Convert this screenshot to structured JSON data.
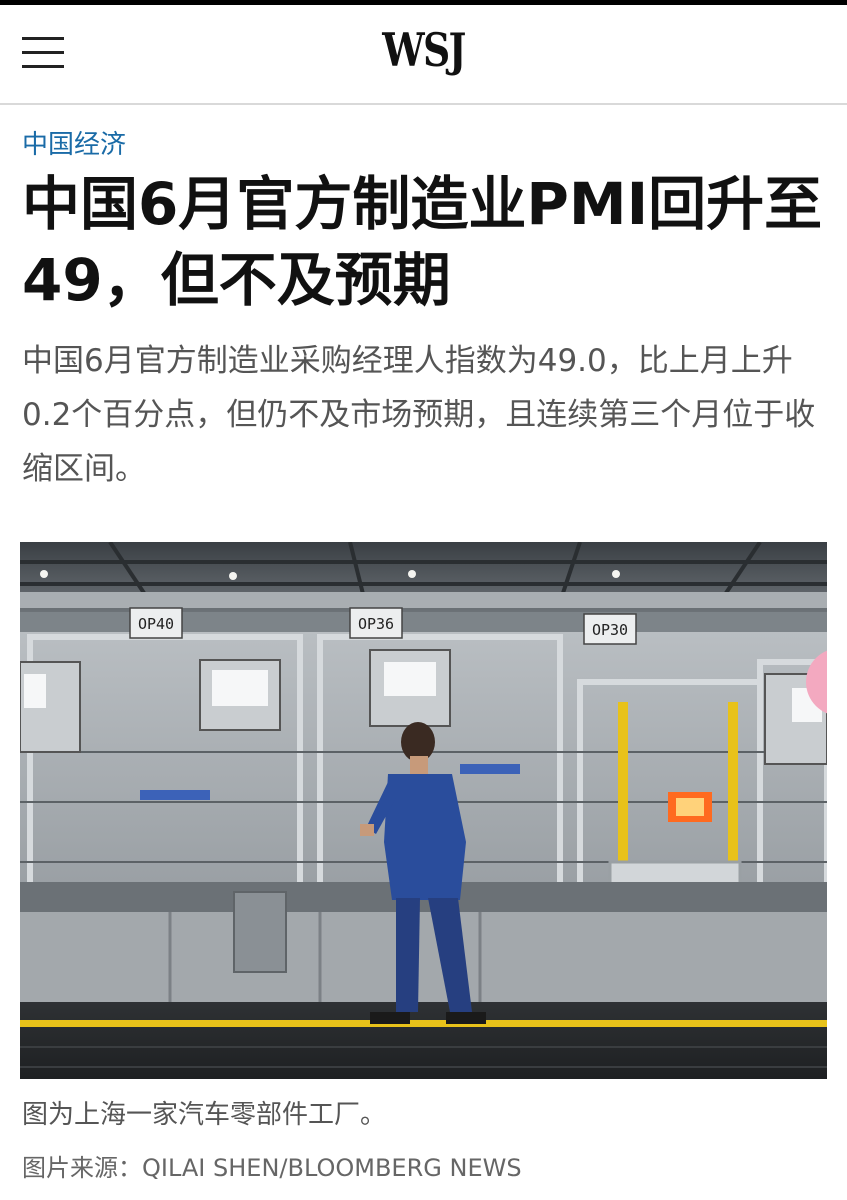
{
  "header": {
    "logo": "WSJ",
    "menu_icon": "hamburger-menu-icon"
  },
  "article": {
    "section": "中国经济",
    "headline": "中国6月官方制造业PMI回升至49，但不及预期",
    "summary": "中国6月官方制造业采购经理人指数为49.0，比上月上升0.2个百分点，但仍不及市场预期，且连续第三个月位于收缩区间。",
    "image": {
      "station_labels": [
        "OP40",
        "OP36",
        "OP30"
      ],
      "caption": "图为上海一家汽车零部件工厂。",
      "credit": "图片来源：QILAI SHEN/BLOOMBERG NEWS"
    }
  },
  "colors": {
    "section_link": "#1a6ba7",
    "worker_uniform": "#2a4d9c",
    "safety_yellow": "#e8c21a"
  }
}
